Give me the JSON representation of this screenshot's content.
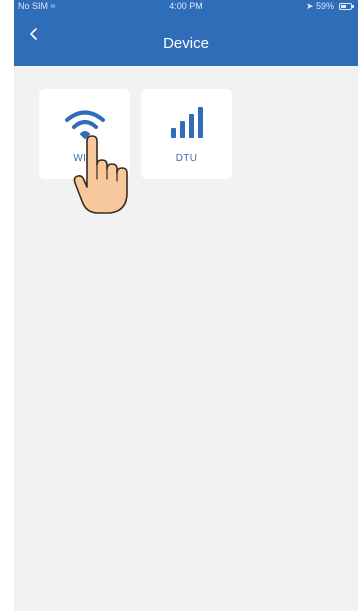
{
  "status_bar": {
    "carrier": "No SIM",
    "time": "4:00 PM",
    "battery": "59%"
  },
  "nav": {
    "back_icon": "chevron-left-icon",
    "title": "Device"
  },
  "devices": [
    {
      "label": "WIFI",
      "icon": "wifi-icon"
    },
    {
      "label": "DTU",
      "icon": "signal-bars-icon"
    }
  ],
  "colors": {
    "header": "#2f6db8",
    "background": "#f2f2f2",
    "card": "#ffffff",
    "accent": "#2f6db8"
  }
}
